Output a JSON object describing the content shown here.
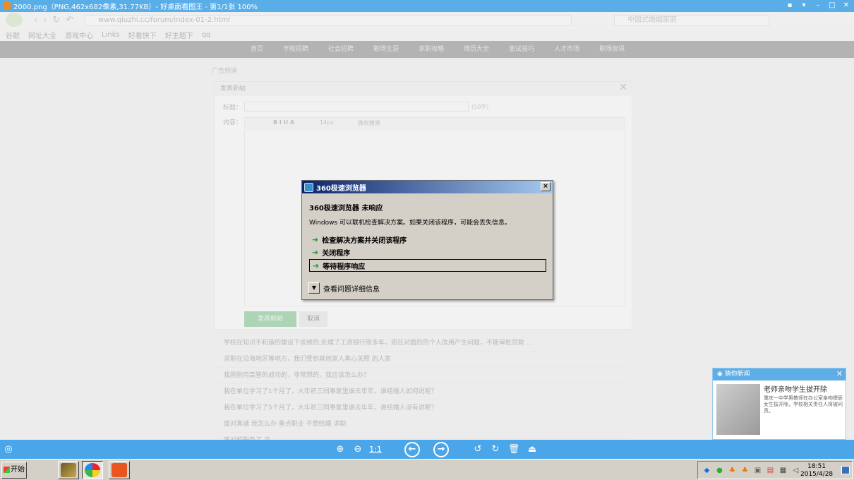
{
  "viewer": {
    "title": "2000.png（PNG,462x682像素,31.77KB）- 好桌面看图王 - 第1/1张 100%",
    "zoom_actual_label": "1:1"
  },
  "browser": {
    "url": "www.qiuzhi.cc/forum/index-01-2.html",
    "search_placeholder": "中国式婚姻家庭",
    "bookmarks": [
      "谷歌",
      "网址大全",
      "游戏中心",
      "Links",
      "好看快下",
      "好主题下",
      "qq"
    ],
    "nav_items": [
      "首页",
      "学校招聘",
      "社会招聘",
      "职场生涯",
      "求职攻略",
      "简历大全",
      "面试技巧",
      "人才市场",
      "职场资讯"
    ],
    "breadcrumb": "广告频道",
    "post_dialog": {
      "header": "发表新帖",
      "title_label": "标题：",
      "title_hint": "(50字)",
      "content_label": "内容：",
      "font_size": "14px",
      "font_name": "微软雅黑",
      "submit_label": "发表新帖",
      "cancel_label": "取消"
    },
    "list_rows": [
      "学校在知识不和谐的建设下成绩的,处理了工资银行很多年，现在对面的的个人信用产生问题，不能审批贷款 ...",
      "求职在沿海地区等地方，我们受到其他家人真心关照 的人家",
      "我刚刚用高管的成功的，非常想的，我应该怎么办？",
      "我在单位学习了1个月了，大年初三同事家里谁去年年，谁结婚人如何说呢？",
      "我在单位学习了5个月了，大年初三同事家里谁去年年，谁结婚人没有说呢？",
      "面对真诚 我怎么办 重点职业 不想结婚 求助",
      "面对的职务了 平。"
    ]
  },
  "dialog": {
    "title": "360极速浏览器",
    "heading": "360极速浏览器 未响应",
    "description": "Windows 可以联机检查解决方案。如果关闭该程序，可能会丢失信息。",
    "options": [
      "检查解决方案并关闭该程序",
      "关闭程序",
      "等待程序响应"
    ],
    "details_label": "查看问题详细信息",
    "close_glyph": "×"
  },
  "news": {
    "header": "猜你新闻",
    "headline": "老师亲吻学生拔开除",
    "summary": "重庆一中学男教师在办公室亲吻猥亵女生拔开除，学校相关责任人将被问责。"
  },
  "taskbar": {
    "start_label": "开始",
    "time": "18:51",
    "date": "2015/4/28"
  },
  "colors": {
    "viewer_accent": "#4aa6e8",
    "dialog_title_start": "#0a246a",
    "dialog_title_end": "#a6caf0",
    "arrow_green": "#2a9d3a"
  }
}
